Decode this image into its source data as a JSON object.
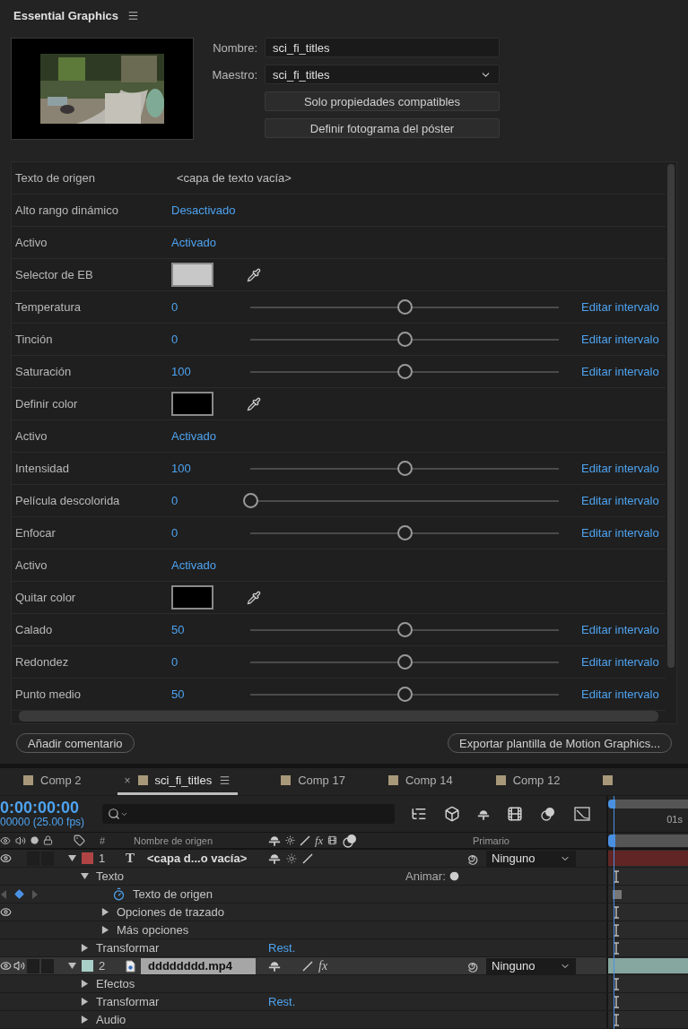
{
  "panel": {
    "title": "Essential Graphics",
    "fields": [
      {
        "label": "Nombre:",
        "kind": "input",
        "value": "sci_fi_titles"
      },
      {
        "label": "Maestro:",
        "kind": "select",
        "value": "sci_fi_titles"
      }
    ],
    "buttons": [
      "Solo propiedades compatibles",
      "Definir fotograma del póster"
    ],
    "properties": [
      {
        "label": "Texto de origen",
        "kind": "text",
        "value": "<capa de texto vacía>"
      },
      {
        "label": "Alto rango dinámico",
        "kind": "toggle",
        "value": "Desactivado"
      },
      {
        "label": "Activo",
        "kind": "toggle",
        "value": "Activado"
      },
      {
        "label": "Selector de EB",
        "kind": "color",
        "color": "#c8c8c8"
      },
      {
        "label": "Temperatura",
        "kind": "slider",
        "value": "0",
        "level": 0.5,
        "link": "Editar intervalo"
      },
      {
        "label": "Tinción",
        "kind": "slider",
        "value": "0",
        "level": 0.5,
        "link": "Editar intervalo"
      },
      {
        "label": "Saturación",
        "kind": "slider",
        "value": "100",
        "level": 0.5,
        "link": "Editar intervalo"
      },
      {
        "label": "Definir color",
        "kind": "color",
        "color": "#000000"
      },
      {
        "label": "Activo",
        "kind": "toggle",
        "value": "Activado"
      },
      {
        "label": "Intensidad",
        "kind": "slider",
        "value": "100",
        "level": 0.5,
        "link": "Editar intervalo"
      },
      {
        "label": "Película descolorida",
        "kind": "slider",
        "value": "0",
        "level": 0,
        "link": "Editar intervalo"
      },
      {
        "label": "Enfocar",
        "kind": "slider",
        "value": "0",
        "level": 0.5,
        "link": "Editar intervalo"
      },
      {
        "label": "Activo",
        "kind": "toggle",
        "value": "Activado"
      },
      {
        "label": "Quitar color",
        "kind": "color",
        "color": "#000000"
      },
      {
        "label": "Calado",
        "kind": "slider",
        "value": "50",
        "level": 0.5,
        "link": "Editar intervalo"
      },
      {
        "label": "Redondez",
        "kind": "slider",
        "value": "0",
        "level": 0.5,
        "link": "Editar intervalo"
      },
      {
        "label": "Punto medio",
        "kind": "slider",
        "value": "50",
        "level": 0.5,
        "link": "Editar intervalo"
      }
    ],
    "footer_buttons": [
      "Añadir comentario",
      "Exportar plantilla de Motion Graphics..."
    ]
  },
  "timeline": {
    "tabs": [
      {
        "label": "Comp 2",
        "selected": false
      },
      {
        "label": "sci_fi_titles",
        "selected": true,
        "close": "×"
      },
      {
        "label": "Comp 17",
        "selected": false
      },
      {
        "label": "Comp 14",
        "selected": false
      },
      {
        "label": "Comp 12",
        "selected": false
      },
      {
        "selected": false
      }
    ],
    "timecode": "0:00:00:00",
    "frame_info": "00000 (25.00 fps)",
    "ruler_labels": [
      "01s"
    ],
    "columns": {
      "number": "#",
      "name": "Nombre de origen",
      "switch_fx": "fx",
      "parent": "Primario"
    },
    "layers": [
      {
        "number": "1",
        "kind": "text",
        "glyph": "T",
        "name": "<capa d...o vacía>",
        "color": "#b04444",
        "visible": true,
        "audio": false,
        "selected": false,
        "expanded": true,
        "parent": "Ninguno",
        "children": [
          {
            "kind": "group",
            "name": "Texto",
            "expanded": true,
            "animate": "Animar:",
            "children": [
              {
                "kind": "property",
                "name": "Texto de origen"
              },
              {
                "kind": "group",
                "name": "Opciones de trazado",
                "expanded": false,
                "eye": true
              },
              {
                "kind": "group",
                "name": "Más opciones",
                "expanded": false
              }
            ]
          },
          {
            "kind": "group",
            "name": "Transformar",
            "expanded": false,
            "reset": "Rest."
          }
        ]
      },
      {
        "number": "2",
        "kind": "footage",
        "name": "dddddddd.mp4",
        "color": "#a8cfc8",
        "visible": true,
        "audio": true,
        "selected": true,
        "expanded": true,
        "parent": "Ninguno",
        "fx": "fx",
        "children": [
          {
            "kind": "group",
            "name": "Efectos",
            "expanded": false
          },
          {
            "kind": "group",
            "name": "Transformar",
            "expanded": false,
            "reset": "Rest."
          },
          {
            "kind": "group",
            "name": "Audio",
            "expanded": false
          }
        ]
      }
    ]
  }
}
